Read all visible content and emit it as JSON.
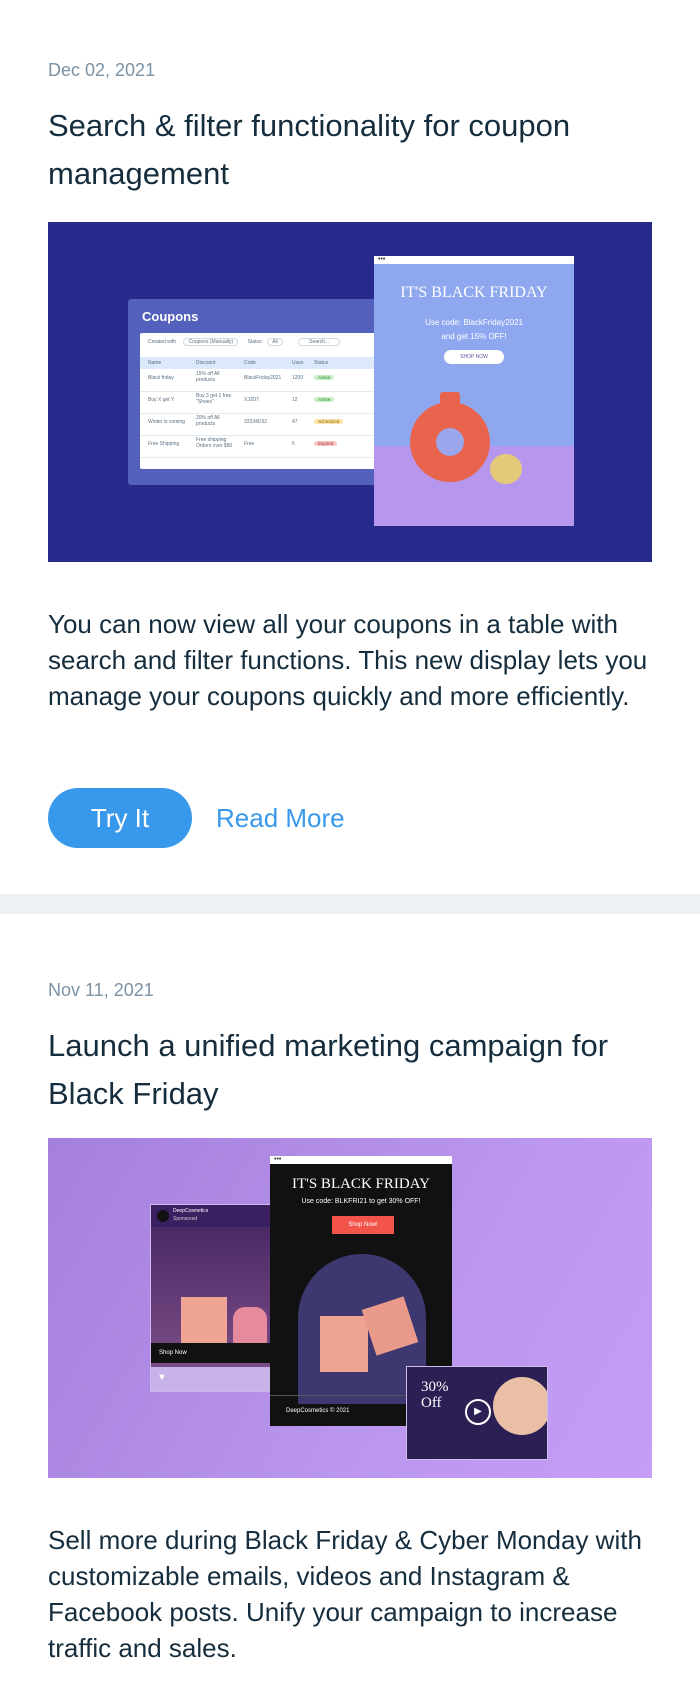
{
  "posts": [
    {
      "date": "Dec 02, 2021",
      "title": "Search & filter functionality for coupon management",
      "description": "You can now view all your coupons in a table with search and filter functions. This new display lets you manage your coupons quickly and more efficiently.",
      "try_label": "Try It",
      "read_more_label": "Read More",
      "hero": {
        "panel_title": "Coupons",
        "filter_created_with": "Created with",
        "filter_created_value": "Coupons (Manually)",
        "filter_status": "Status",
        "filter_status_value": "All",
        "search_placeholder": "Search...",
        "columns": [
          "Name",
          "Discount",
          "Code",
          "Uses",
          "Status"
        ],
        "rows": [
          [
            "Black friday",
            "15% off All products",
            "BlackFriday2021",
            "1200",
            "Active"
          ],
          [
            "Buy X get Y",
            "Buy 3 get 1 free \"Shoes\"",
            "XJJD7",
            "12",
            "Active"
          ],
          [
            "Winter is coming",
            "20% off All products",
            "33334D32",
            "47",
            "Scheduled"
          ],
          [
            "Free Shipping",
            "Free shipping Orders over $90",
            "Free",
            "5",
            "Expired"
          ]
        ],
        "store_headline": "IT'S BLACK FRIDAY",
        "store_sub_1": "Use code: BlackFriday2021",
        "store_sub_2": "and get 15% OFF!",
        "store_button": "SHOP NOW"
      }
    },
    {
      "date": "Nov 11, 2021",
      "title": "Launch a unified marketing campaign for Black Friday",
      "description": "Sell more during Black Friday & Cyber Monday with customizable emails, videos and Instagram & Facebook posts. Unify your campaign to increase traffic and sales.",
      "hero": {
        "insta_account": "DeepCosmetics",
        "insta_sponsored": "Sponsored",
        "insta_shop": "Shop Now",
        "email_headline": "IT'S BLACK FRIDAY",
        "email_code": "Use code: BLKFRI21 to get 30% OFF!",
        "email_button": "Shop Now!",
        "email_footer": "DeepCosmetics © 2021",
        "video_text_1": "30%",
        "video_text_2": "Off"
      }
    }
  ]
}
